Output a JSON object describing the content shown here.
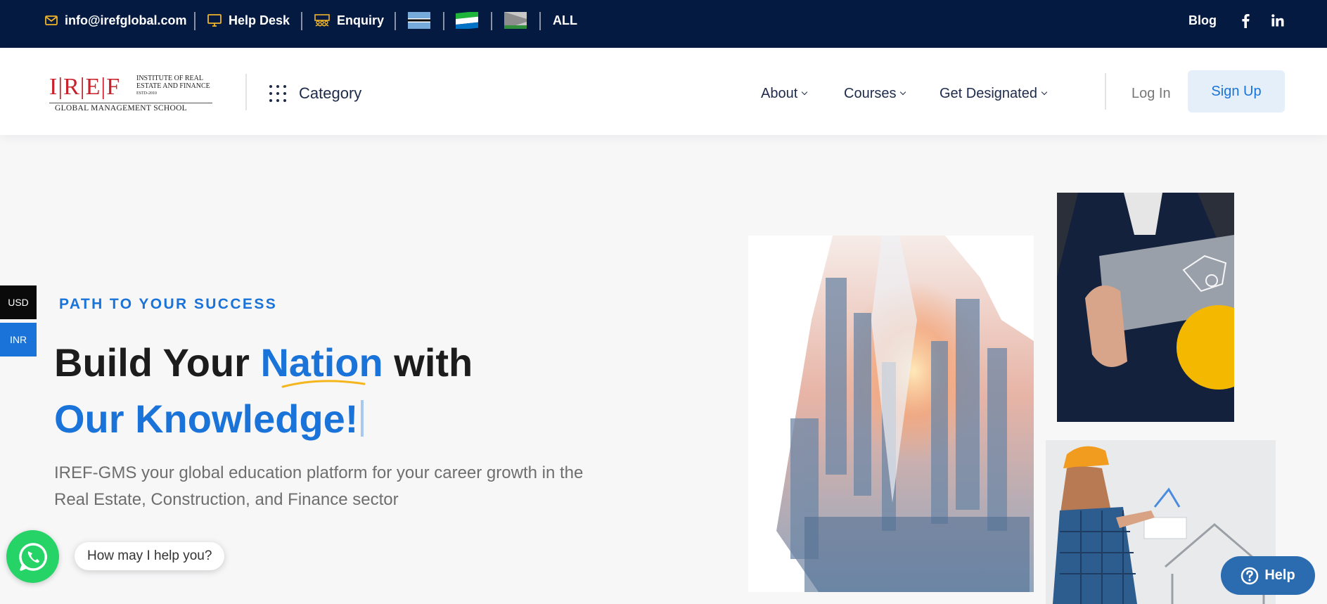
{
  "topbar": {
    "email": "info@irefglobal.com",
    "helpdesk": "Help Desk",
    "enquiry": "Enquiry",
    "region_all": "ALL",
    "blog": "Blog",
    "social": [
      "facebook-icon",
      "linkedin-icon"
    ]
  },
  "header": {
    "logo": {
      "letters": "I|R|E|F",
      "line1": "INSTITUTE OF REAL",
      "line2": "ESTATE AND FINANCE",
      "line3": "ESTD-2010",
      "bottom": "GLOBAL MANAGEMENT SCHOOL"
    },
    "category": "Category",
    "nav": [
      "About",
      "Courses",
      "Get Designated"
    ],
    "login": "Log In",
    "signup": "Sign Up"
  },
  "currency": {
    "usd": "USD",
    "inr": "INR"
  },
  "hero": {
    "kicker": "PATH TO YOUR SUCCESS",
    "h1_part1": "Build Your ",
    "h1_highlight": "Nation",
    "h1_part2": " with",
    "h1_line2": "Our Knowledge!",
    "description": "IREF-GMS your global education platform for your career growth in the Real Estate, Construction, and Finance sector"
  },
  "chat": {
    "prompt": "How may I help you?",
    "help": "Help"
  },
  "colors": {
    "topbar": "#041a41",
    "accent": "#1a73d9",
    "whatsapp": "#25d366",
    "help": "#2b6cb0"
  }
}
